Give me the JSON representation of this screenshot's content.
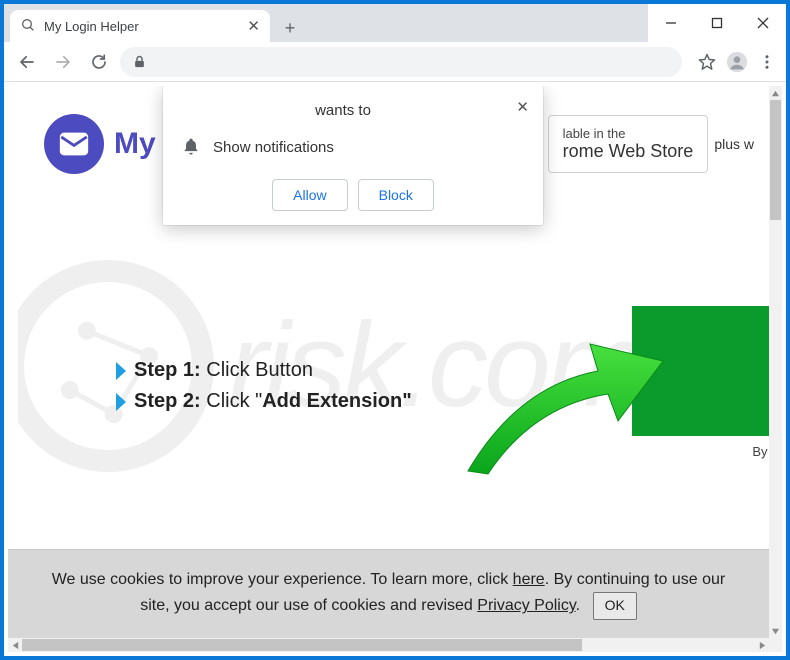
{
  "window": {
    "tab_title": "My Login Helper",
    "close_glyph": "✕",
    "newtab_glyph": "+"
  },
  "toolbar": {
    "icons": {
      "back": "back-icon",
      "forward": "forward-icon",
      "reload": "reload-icon",
      "lock": "lock-icon",
      "star": "star-icon",
      "profile": "profile-icon",
      "menu": "menu-icon"
    }
  },
  "page": {
    "brand_prefix": "My",
    "store_badge": {
      "line1": "lable in the",
      "line2": "rome Web Store"
    },
    "plus_text": "plus w",
    "steps": [
      {
        "label": "Step 1:",
        "text": " Click Button"
      },
      {
        "label": "Step 2:",
        "text": " Click \"",
        "bold_tail": "Add Extension\""
      }
    ],
    "byline": "By In"
  },
  "permission": {
    "title": "wants to",
    "request": "Show notifications",
    "allow": "Allow",
    "block": "Block",
    "close_glyph": "✕"
  },
  "cookies": {
    "part1": "We use cookies to improve your experience. To learn more, click ",
    "here": "here",
    "part2": ". By continuing to use our site, you accept our use of cookies and revised ",
    "privacy": "Privacy Policy",
    "dot": ".",
    "ok": "OK"
  },
  "colors": {
    "brand": "#4d4bc0",
    "green": "#0b9a2c",
    "arrow": "#21c421",
    "win_border": "#0a78d6",
    "chrome_blue": "#1a73e8"
  },
  "watermark_text": "PCrisk.com"
}
